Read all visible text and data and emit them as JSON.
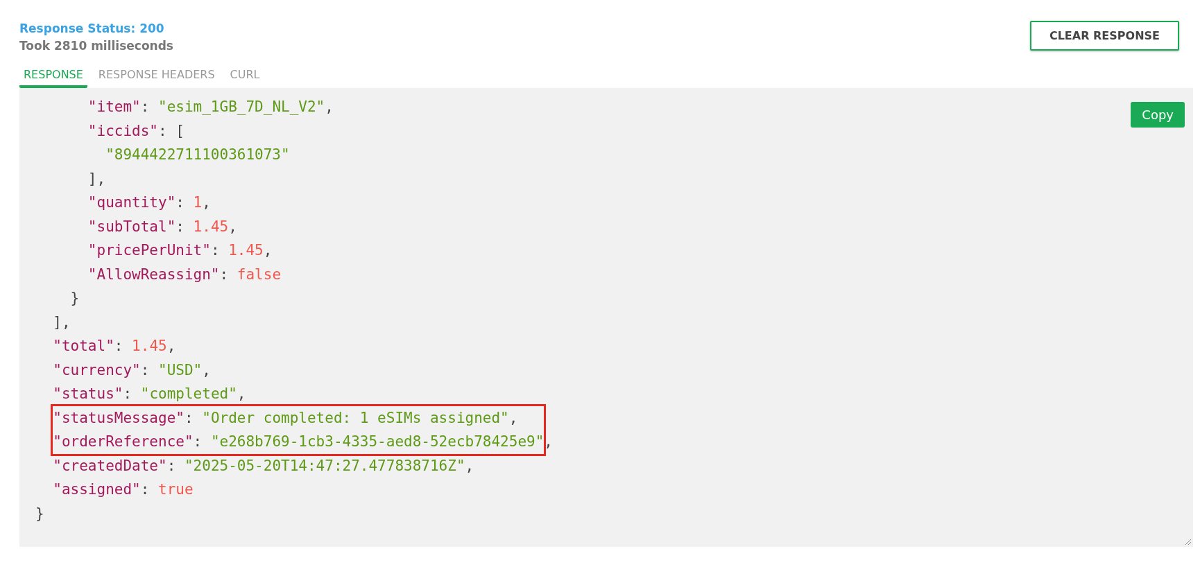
{
  "header": {
    "status": "Response Status: 200",
    "duration": "Took 2810 milliseconds",
    "clear_button": "CLEAR RESPONSE"
  },
  "tabs": [
    {
      "label": "RESPONSE",
      "selected": true
    },
    {
      "label": "RESPONSE HEADERS",
      "selected": false
    },
    {
      "label": "CURL",
      "selected": false
    }
  ],
  "copy_button": "Copy",
  "code": [
    {
      "kind": "plain",
      "lines": [
        {
          "tokens": [
            {
              "kind": "key",
              "text": "      \"item\""
            },
            {
              "kind": "punct",
              "text": ": "
            },
            {
              "kind": "string",
              "text": "\"esim_1GB_7D_NL_V2\""
            },
            {
              "kind": "punct",
              "text": ","
            }
          ]
        },
        {
          "tokens": [
            {
              "kind": "key",
              "text": "      \"iccids\""
            },
            {
              "kind": "punct",
              "text": ": ["
            }
          ]
        },
        {
          "tokens": [
            {
              "kind": "string",
              "text": "        \"8944422711100361073\""
            }
          ]
        },
        {
          "tokens": [
            {
              "kind": "punct",
              "text": "      ],"
            }
          ]
        },
        {
          "tokens": [
            {
              "kind": "key",
              "text": "      \"quantity\""
            },
            {
              "kind": "punct",
              "text": ": "
            },
            {
              "kind": "number",
              "text": "1"
            },
            {
              "kind": "punct",
              "text": ","
            }
          ]
        },
        {
          "tokens": [
            {
              "kind": "key",
              "text": "      \"subTotal\""
            },
            {
              "kind": "punct",
              "text": ": "
            },
            {
              "kind": "number",
              "text": "1.45"
            },
            {
              "kind": "punct",
              "text": ","
            }
          ]
        },
        {
          "tokens": [
            {
              "kind": "key",
              "text": "      \"pricePerUnit\""
            },
            {
              "kind": "punct",
              "text": ": "
            },
            {
              "kind": "number",
              "text": "1.45"
            },
            {
              "kind": "punct",
              "text": ","
            }
          ]
        },
        {
          "tokens": [
            {
              "kind": "key",
              "text": "      \"AllowReassign\""
            },
            {
              "kind": "punct",
              "text": ": "
            },
            {
              "kind": "literal",
              "text": "false"
            }
          ]
        },
        {
          "tokens": [
            {
              "kind": "punct",
              "text": "    }"
            }
          ]
        },
        {
          "tokens": [
            {
              "kind": "punct",
              "text": "  ],"
            }
          ]
        },
        {
          "tokens": [
            {
              "kind": "key",
              "text": "  \"total\""
            },
            {
              "kind": "punct",
              "text": ": "
            },
            {
              "kind": "number",
              "text": "1.45"
            },
            {
              "kind": "punct",
              "text": ","
            }
          ]
        },
        {
          "tokens": [
            {
              "kind": "key",
              "text": "  \"currency\""
            },
            {
              "kind": "punct",
              "text": ": "
            },
            {
              "kind": "string",
              "text": "\"USD\""
            },
            {
              "kind": "punct",
              "text": ","
            }
          ]
        },
        {
          "tokens": [
            {
              "kind": "key",
              "text": "  \"status\""
            },
            {
              "kind": "punct",
              "text": ": "
            },
            {
              "kind": "string",
              "text": "\"completed\""
            },
            {
              "kind": "punct",
              "text": ","
            }
          ]
        }
      ]
    },
    {
      "kind": "highlight",
      "after": ",",
      "lines": [
        {
          "tokens": [
            {
              "kind": "key",
              "text": "\"statusMessage\""
            },
            {
              "kind": "punct",
              "text": ": "
            },
            {
              "kind": "string",
              "text": "\"Order completed: 1 eSIMs assigned\""
            },
            {
              "kind": "punct",
              "text": ","
            }
          ]
        },
        {
          "tokens": [
            {
              "kind": "key",
              "text": "\"orderReference\""
            },
            {
              "kind": "punct",
              "text": ": "
            },
            {
              "kind": "string",
              "text": "\"e268b769-1cb3-4335-aed8-52ecb78425e9\""
            }
          ]
        }
      ]
    },
    {
      "kind": "plain",
      "lines": [
        {
          "tokens": [
            {
              "kind": "key",
              "text": "  \"createdDate\""
            },
            {
              "kind": "punct",
              "text": ": "
            },
            {
              "kind": "string",
              "text": "\"2025-05-20T14:47:27.477838716Z\""
            },
            {
              "kind": "punct",
              "text": ","
            }
          ]
        },
        {
          "tokens": [
            {
              "kind": "key",
              "text": "  \"assigned\""
            },
            {
              "kind": "punct",
              "text": ": "
            },
            {
              "kind": "literal",
              "text": "true"
            }
          ]
        },
        {
          "tokens": [
            {
              "kind": "punct",
              "text": "}"
            }
          ]
        }
      ]
    }
  ]
}
